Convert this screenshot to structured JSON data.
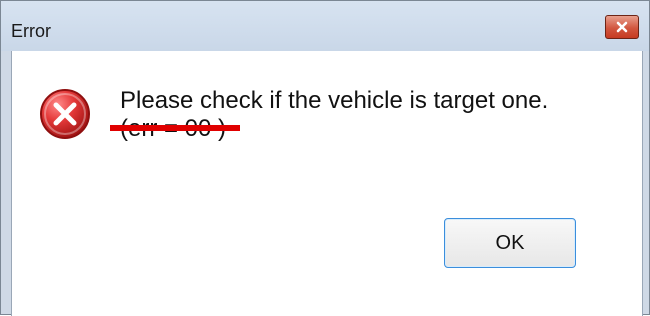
{
  "window": {
    "title": "Error"
  },
  "message": {
    "text": "Please check if the vehicle is target one.",
    "code": "(err = 00 )"
  },
  "buttons": {
    "ok": "OK"
  },
  "icons": {
    "error": "error-icon",
    "close": "close-icon"
  },
  "colors": {
    "error_red": "#d62828",
    "annotation_red": "#e00000",
    "focus_blue": "#3b8edc"
  }
}
